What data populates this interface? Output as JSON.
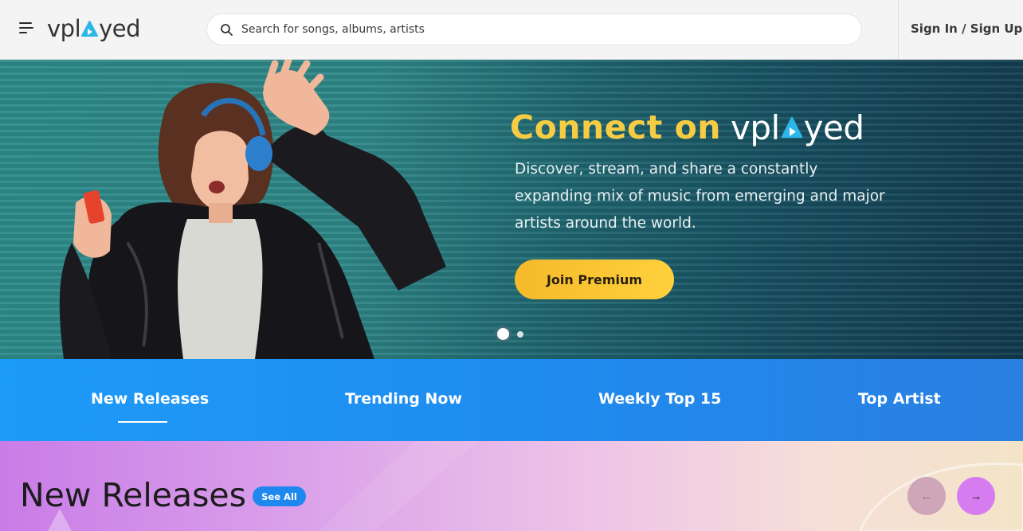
{
  "header": {
    "logo_parts": {
      "before": "vpl",
      "after": "yed"
    },
    "search": {
      "placeholder": "Search for songs, albums, artists",
      "value": ""
    },
    "auth": {
      "sign_in": "Sign In",
      "separator": "/",
      "sign_up": "Sign Up"
    }
  },
  "hero": {
    "title_prefix": "Connect on",
    "brand_parts": {
      "before": "vpl",
      "after": "yed"
    },
    "description": "Discover, stream, and share a constantly expanding mix of music from emerging and major artists around the world.",
    "cta_label": "Join Premium",
    "slide_count": 2,
    "active_slide": 1
  },
  "tabs": {
    "items": [
      {
        "label": "New Releases",
        "active": true
      },
      {
        "label": "Trending Now",
        "active": false
      },
      {
        "label": "Weekly Top 15",
        "active": false
      },
      {
        "label": "Top Artist",
        "active": false
      }
    ]
  },
  "new_releases": {
    "title": "New Releases",
    "see_all_label": "See All",
    "prev_icon": "arrow-left-icon",
    "next_icon": "arrow-right-icon"
  },
  "colors": {
    "accent_blue": "#1e88ee",
    "gold": "#f7cc45",
    "logo_triangle": "#2bb7e8"
  }
}
